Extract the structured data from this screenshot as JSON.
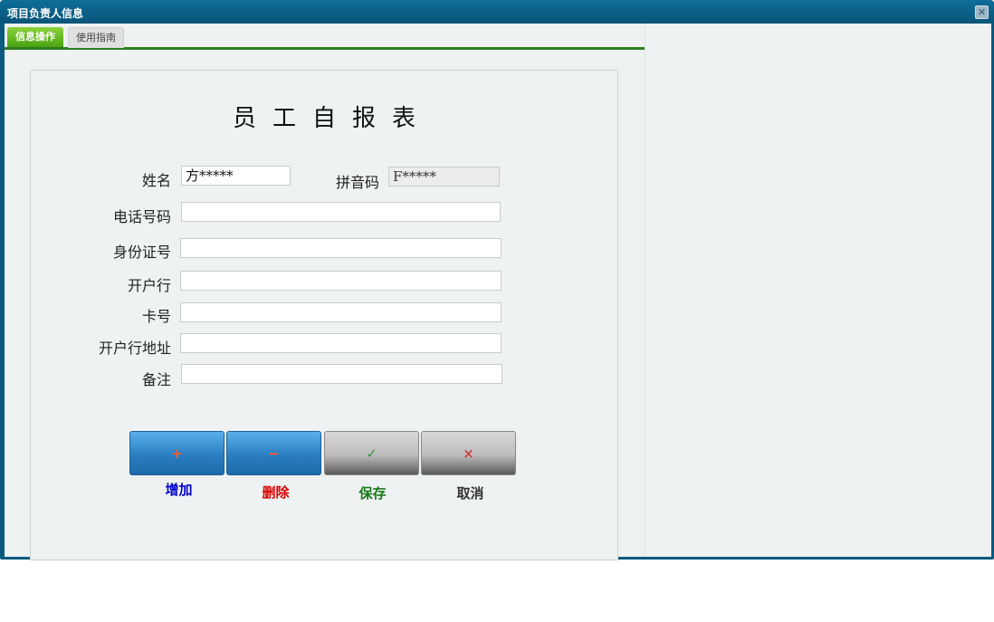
{
  "window": {
    "title": "项目负责人信息",
    "close_symbol": "✕"
  },
  "tabs": [
    {
      "label": "信息操作",
      "active": true
    },
    {
      "label": "使用指南",
      "active": false
    }
  ],
  "form": {
    "title": "员工自报表",
    "fields": {
      "name": {
        "label": "姓名",
        "value": "方*****"
      },
      "pinyin": {
        "label": "拼音码",
        "value": "F*****"
      },
      "phone": {
        "label": "电话号码",
        "value": ""
      },
      "id_number": {
        "label": "身份证号",
        "value": ""
      },
      "bank": {
        "label": "开户行",
        "value": ""
      },
      "card_no": {
        "label": "卡号",
        "value": ""
      },
      "bank_address": {
        "label": "开户行地址",
        "value": ""
      },
      "remark": {
        "label": "备注",
        "value": ""
      }
    }
  },
  "buttons": {
    "add": {
      "symbol": "+",
      "label": "增加",
      "color": "#0000cc"
    },
    "delete": {
      "symbol": "−",
      "label": "删除",
      "color": "#dd0000"
    },
    "save": {
      "symbol": "✓",
      "label": "保存",
      "color": "#1a7a1a"
    },
    "cancel": {
      "symbol": "×",
      "label": "取消",
      "color": "#333333"
    }
  },
  "colors": {
    "title_bar": "#0a5a80",
    "active_tab": "#4aa212",
    "tab_underline": "#2e7d1e",
    "primary_button": "#2a7ec2"
  },
  "icons": {
    "close": "close-icon",
    "add": "plus-icon",
    "delete": "minus-icon",
    "save": "check-icon",
    "cancel": "x-icon"
  }
}
